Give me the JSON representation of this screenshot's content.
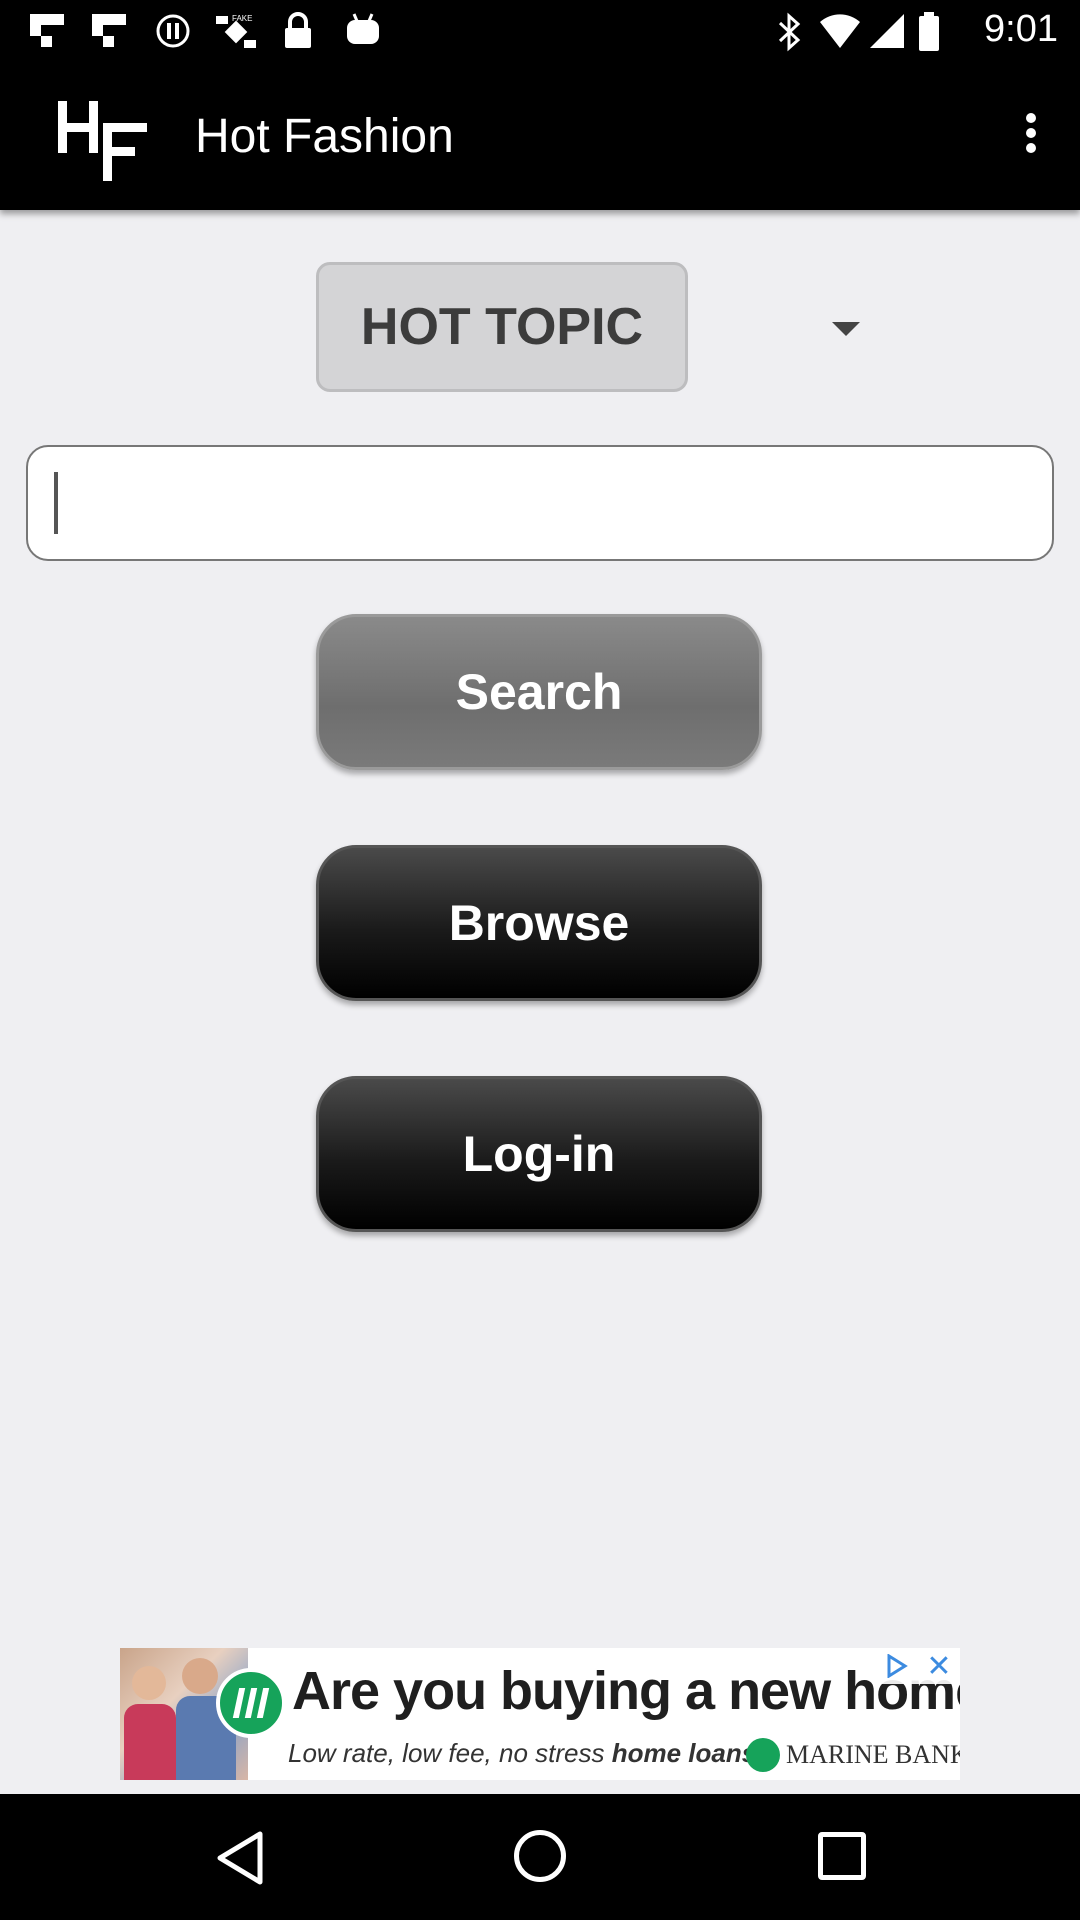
{
  "status_bar": {
    "time": "9:01",
    "icons": [
      "flipboard-icon",
      "flipboard-icon",
      "circle-icon",
      "satellite-icon",
      "lock-icon",
      "android-icon",
      "bluetooth-icon",
      "wifi-icon",
      "signal-icon",
      "battery-icon"
    ]
  },
  "app_bar": {
    "logo": "HF",
    "title": "Hot Fashion",
    "menu_icon": "overflow-menu-icon"
  },
  "topic_spinner": {
    "selected": "HOT TOPIC",
    "arrow_icon": "dropdown-arrow-icon"
  },
  "search_field": {
    "value": "",
    "placeholder": ""
  },
  "buttons": {
    "search": "Search",
    "browse": "Browse",
    "login": "Log-in"
  },
  "ad": {
    "headline": "Are you buying a new home?",
    "subline_prefix": "Low rate, low fee, no stress ",
    "subline_bold": "home loans",
    "advertiser": "MARINE BANK",
    "close_icon": "close-icon",
    "adchoices_icon": "ad-choices-icon"
  },
  "nav_bar": {
    "back": "back-icon",
    "home": "home-icon",
    "recents": "recents-icon"
  }
}
